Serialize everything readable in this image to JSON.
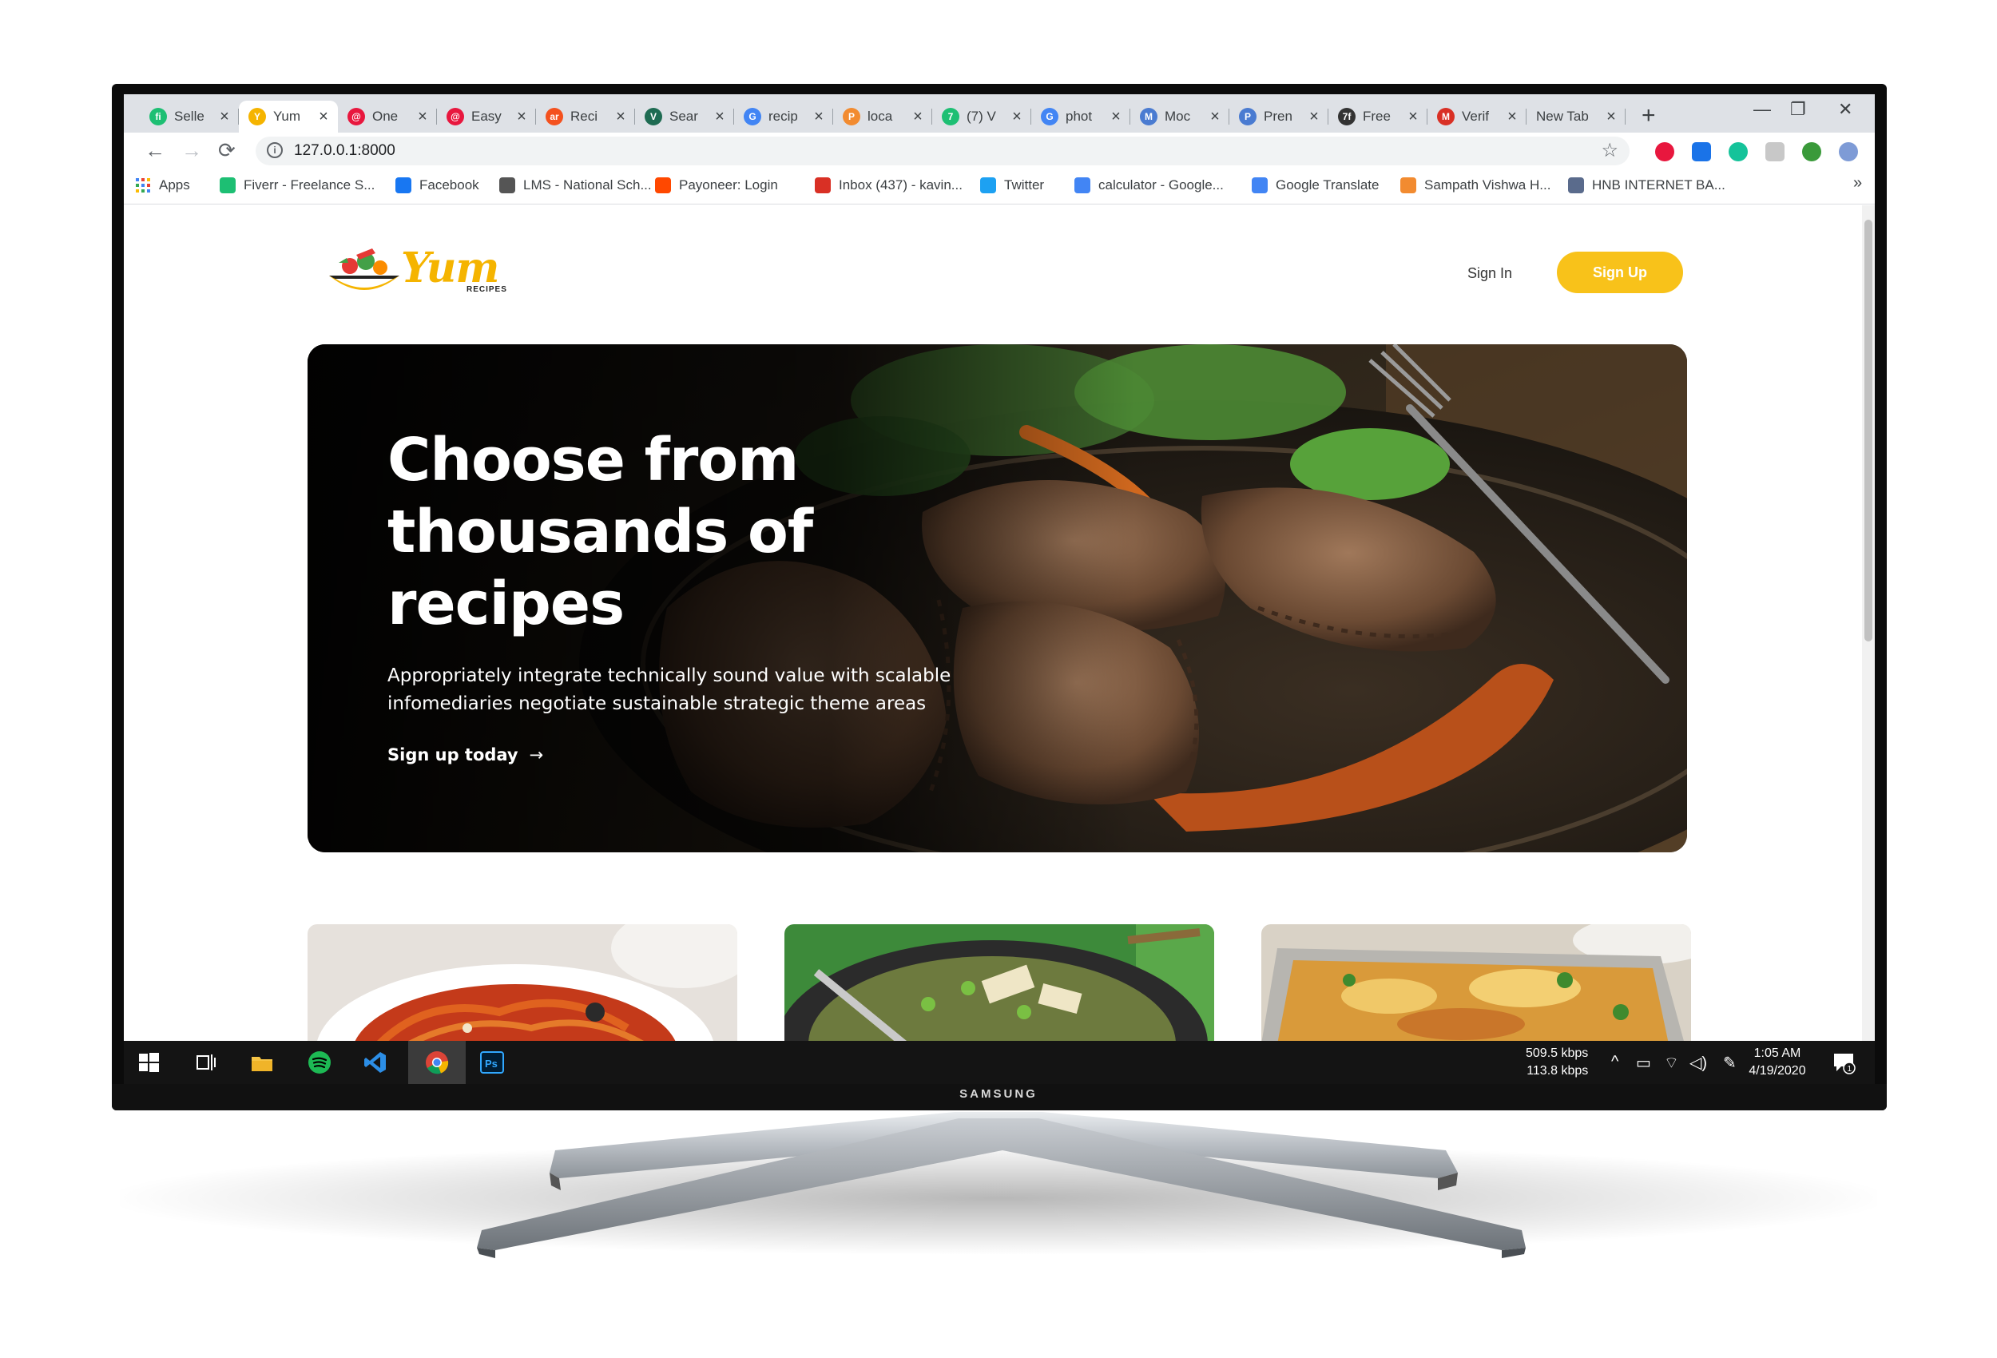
{
  "browser": {
    "tabs": [
      {
        "title": "Selle",
        "favicon_color": "#1dbf73",
        "favicon_text": "fi"
      },
      {
        "title": "Yum",
        "favicon_color": "#f5b400",
        "favicon_text": "Y",
        "active": true
      },
      {
        "title": "One",
        "favicon_color": "#e8173e",
        "favicon_text": "@"
      },
      {
        "title": "Easy",
        "favicon_color": "#e8173e",
        "favicon_text": "@"
      },
      {
        "title": "Reci",
        "favicon_color": "#f4511e",
        "favicon_text": "ar"
      },
      {
        "title": "Sear",
        "favicon_color": "#1e6b52",
        "favicon_text": "V"
      },
      {
        "title": "recip",
        "favicon_color": "#4285f4",
        "favicon_text": "G"
      },
      {
        "title": "loca",
        "favicon_color": "#f28b30",
        "favicon_text": "P"
      },
      {
        "title": "(7) V",
        "favicon_color": "#1dbf73",
        "favicon_text": "7"
      },
      {
        "title": "phot",
        "favicon_color": "#4285f4",
        "favicon_text": "G"
      },
      {
        "title": "Moc",
        "favicon_color": "#4a7bd1",
        "favicon_text": "M"
      },
      {
        "title": "Pren",
        "favicon_color": "#4a7bd1",
        "favicon_text": "P"
      },
      {
        "title": "Free",
        "favicon_color": "#333333",
        "favicon_text": "7f"
      },
      {
        "title": "Verif",
        "favicon_color": "#d93025",
        "favicon_text": "M"
      },
      {
        "title": "New Tab",
        "favicon_color": "",
        "favicon_text": ""
      }
    ],
    "new_tab_symbol": "+",
    "window_controls": {
      "minimize": "—",
      "restore": "❐",
      "close": "✕"
    },
    "url": "127.0.0.1:8000",
    "extensions": [
      "abp-icon",
      "reader-icon",
      "grammarly-icon",
      "ext-icon",
      "globe-icon",
      "ext-icon-2",
      "ext-icon-3",
      "ext-icon-4",
      "profile-avatar"
    ],
    "bookmarks": [
      {
        "label": "Apps",
        "icon": "apps-grid-icon",
        "color": "#4285f4"
      },
      {
        "label": "Fiverr - Freelance S...",
        "icon": "fiverr-icon",
        "color": "#1dbf73"
      },
      {
        "label": "Facebook",
        "icon": "facebook-icon",
        "color": "#1877f2"
      },
      {
        "label": "LMS - National Sch...",
        "icon": "lms-icon",
        "color": "#555555"
      },
      {
        "label": "Payoneer: Login",
        "icon": "payoneer-icon",
        "color": "#ff4800"
      },
      {
        "label": "Inbox (437) - kavin...",
        "icon": "gmail-icon",
        "color": "#d93025"
      },
      {
        "label": "Twitter",
        "icon": "twitter-icon",
        "color": "#1da1f2"
      },
      {
        "label": "calculator - Google...",
        "icon": "google-icon",
        "color": "#4285f4"
      },
      {
        "label": "Google Translate",
        "icon": "translate-icon",
        "color": "#4285f4"
      },
      {
        "label": "Sampath Vishwa H...",
        "icon": "sampath-icon",
        "color": "#f28b30"
      },
      {
        "label": "HNB INTERNET BA...",
        "icon": "hnb-icon",
        "color": "#5a6b8c"
      }
    ],
    "bookmarks_more": "»"
  },
  "site": {
    "logo_text": "Yum",
    "logo_sub": "RECIPES",
    "nav": {
      "signin": "Sign In",
      "signup": "Sign Up"
    },
    "hero": {
      "title": "Choose from thousands of recipes",
      "subtitle": "Appropriately integrate technically sound value with scalable infomediaries negotiate sustainable strategic theme areas",
      "cta": "Sign up today",
      "cta_arrow": "→"
    },
    "cards": [
      {
        "dish": "spaghetti"
      },
      {
        "dish": "vegetable-stir-fry"
      },
      {
        "dish": "lasagna"
      }
    ]
  },
  "taskbar": {
    "network_up": "509.5 kbps",
    "network_down": "113.8 kbps",
    "time": "1:05 AM",
    "date": "4/19/2020",
    "notification_count": "1",
    "apps": [
      "windows-start-icon",
      "task-view-icon",
      "file-explorer-icon",
      "spotify-icon",
      "vscode-icon",
      "chrome-icon",
      "photoshop-icon"
    ]
  },
  "monitor": {
    "brand": "SAMSUNG"
  },
  "colors": {
    "accent": "#f8c21a",
    "logo": "#f5b400"
  }
}
